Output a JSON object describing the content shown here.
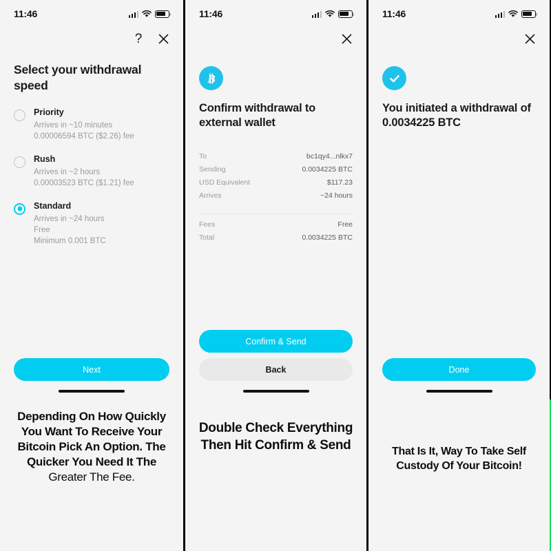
{
  "status_bar": {
    "time": "11:46",
    "signal_icon": "cellular-bars-icon",
    "wifi_icon": "wifi-icon",
    "battery_icon": "battery-icon"
  },
  "colors": {
    "accent": "#00cdf0",
    "badge": "#1ec2ea",
    "panel_bg": "#f4f4f4",
    "muted_text": "#9b9b9b",
    "secondary_button": "#e9e9e9",
    "gradient_start": "#adf7f2",
    "gradient_end": "#0ee05c"
  },
  "panels": [
    {
      "id": "withdrawal-speed",
      "nav": {
        "help_label": "?",
        "close_label": "×"
      },
      "title": "Select your withdrawal speed",
      "options": [
        {
          "label": "Priority",
          "lines": [
            "Arrives in ~10 minutes",
            "0.00006594 BTC ($2.26) fee"
          ],
          "selected": false
        },
        {
          "label": "Rush",
          "lines": [
            "Arrives in ~2 hours",
            "0.00003523 BTC ($1.21) fee"
          ],
          "selected": false
        },
        {
          "label": "Standard",
          "lines": [
            "Arrives in ~24 hours",
            "Free",
            "Minimum 0.001 BTC"
          ],
          "selected": true
        }
      ],
      "primary_button": "Next",
      "caption_bold": "Depending On How Quickly You Want To Receive Your Bitcoin Pick An Option. The Quicker You Need It The ",
      "caption_light": "Greater The Fee."
    },
    {
      "id": "confirm-withdrawal",
      "nav": {
        "close_label": "×"
      },
      "badge_icon": "bitcoin-icon",
      "title": "Confirm withdrawal to external wallet",
      "details": [
        {
          "label": "To",
          "value": "bc1qy4...nlkx7"
        },
        {
          "label": "Sending",
          "value": "0.0034225 BTC"
        },
        {
          "label": "USD Equivalent",
          "value": "$117.23"
        },
        {
          "label": "Arrives",
          "value": "~24 hours"
        }
      ],
      "totals": [
        {
          "label": "Fees",
          "value": "Free"
        },
        {
          "label": "Total",
          "value": "0.0034225 BTC"
        }
      ],
      "primary_button": "Confirm & Send",
      "secondary_button": "Back",
      "caption_bold": "Double Check Everything Then Hit Confirm & Send"
    },
    {
      "id": "withdrawal-initiated",
      "nav": {
        "close_label": "×"
      },
      "badge_icon": "check-icon",
      "title": "You initiated a withdrawal of 0.0034225 BTC",
      "primary_button": "Done",
      "caption_bold": "That Is It, Way To Take Self Custody Of Your Bitcoin!"
    }
  ]
}
